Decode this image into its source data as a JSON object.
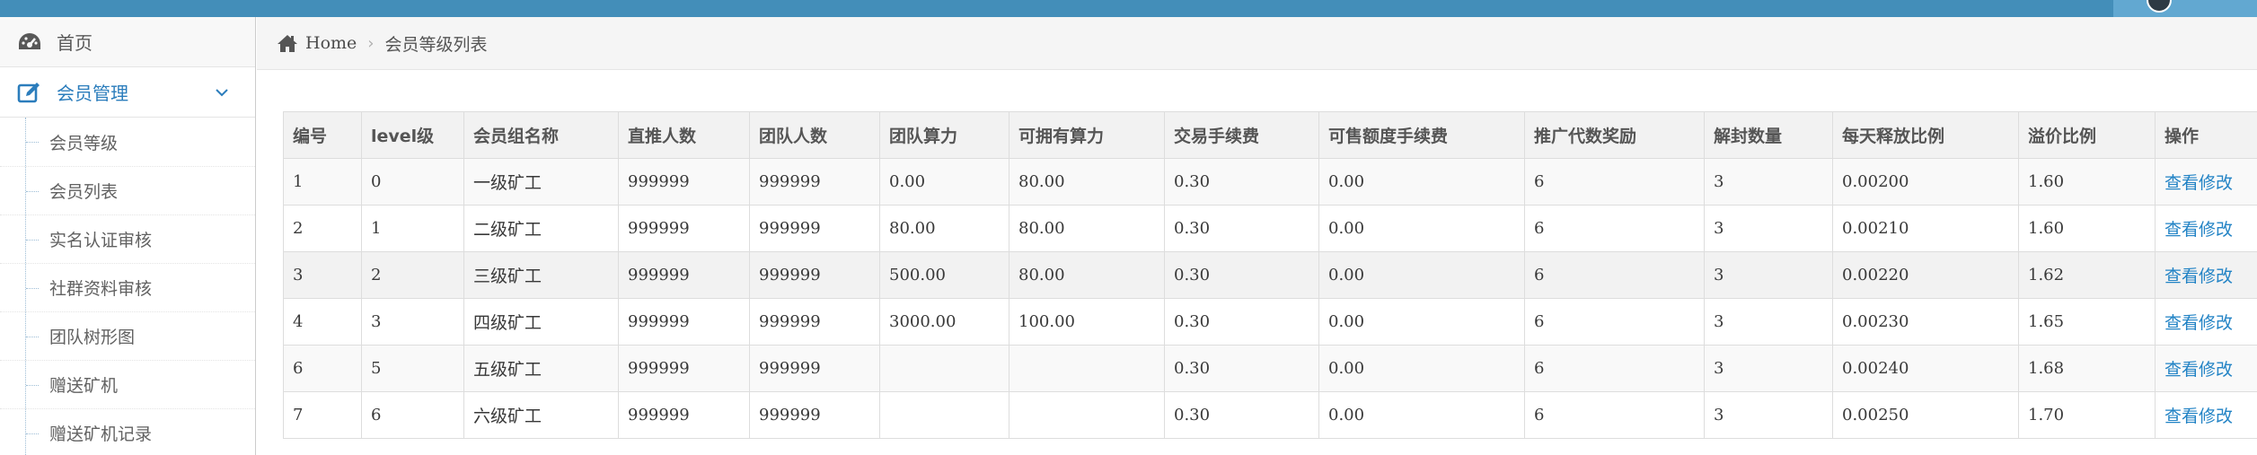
{
  "sidebar": {
    "items": [
      {
        "label": "首页",
        "icon": "dashboard-icon"
      },
      {
        "label": "会员管理",
        "icon": "edit-icon",
        "open": true
      }
    ],
    "subitems": [
      {
        "label": "会员等级"
      },
      {
        "label": "会员列表"
      },
      {
        "label": "实名认证审核"
      },
      {
        "label": "社群资料审核"
      },
      {
        "label": "团队树形图"
      },
      {
        "label": "赠送矿机"
      },
      {
        "label": "赠送矿机记录"
      }
    ]
  },
  "breadcrumb": {
    "home": "Home",
    "sep": "›",
    "current": "会员等级列表"
  },
  "table": {
    "headers": [
      "编号",
      "level级",
      "会员组名称",
      "直推人数",
      "团队人数",
      "团队算力",
      "可拥有算力",
      "交易手续费",
      "可售额度手续费",
      "推广代数奖励",
      "解封数量",
      "每天释放比例",
      "溢价比例",
      "操作"
    ],
    "rows": [
      [
        "1",
        "0",
        "一级矿工",
        "999999",
        "999999",
        "0.00",
        "80.00",
        "0.30",
        "0.00",
        "6",
        "3",
        "0.00200",
        "1.60",
        "查看修改"
      ],
      [
        "2",
        "1",
        "二级矿工",
        "999999",
        "999999",
        "80.00",
        "80.00",
        "0.30",
        "0.00",
        "6",
        "3",
        "0.00210",
        "1.60",
        "查看修改"
      ],
      [
        "3",
        "2",
        "三级矿工",
        "999999",
        "999999",
        "500.00",
        "80.00",
        "0.30",
        "0.00",
        "6",
        "3",
        "0.00220",
        "1.62",
        "查看修改"
      ],
      [
        "4",
        "3",
        "四级矿工",
        "999999",
        "999999",
        "3000.00",
        "100.00",
        "0.30",
        "0.00",
        "6",
        "3",
        "0.00230",
        "1.65",
        "查看修改"
      ],
      [
        "6",
        "5",
        "五级矿工",
        "999999",
        "999999",
        "",
        "",
        "0.30",
        "0.00",
        "6",
        "3",
        "0.00240",
        "1.68",
        "查看修改"
      ],
      [
        "7",
        "6",
        "六级矿工",
        "999999",
        "999999",
        "",
        "",
        "0.30",
        "0.00",
        "6",
        "3",
        "0.00250",
        "1.70",
        "查看修改"
      ]
    ]
  },
  "colors": {
    "topbar": "#438eb9",
    "link": "#2283c5",
    "active_menu": "#2b7dbc"
  }
}
